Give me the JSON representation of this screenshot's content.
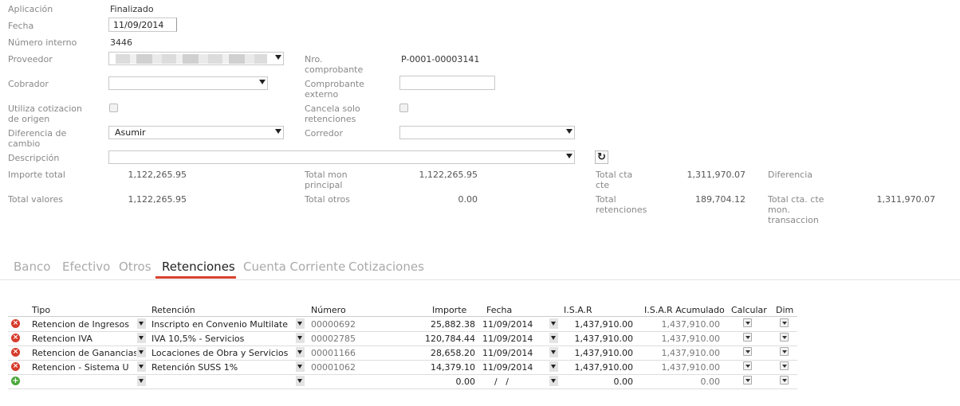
{
  "form": {
    "aplicacion_label": "Aplicación",
    "aplicacion_value": "Finalizado",
    "fecha_label": "Fecha",
    "fecha_value": "11/09/2014",
    "numero_interno_label": "Número interno",
    "numero_interno_value": "3446",
    "proveedor_label": "Proveedor",
    "nro_comprobante_label_1": "Nro.",
    "nro_comprobante_label_2": "comprobante",
    "nro_comprobante_value": "P-0001-00003141",
    "cobrador_label": "Cobrador",
    "comprobante_externo_label_1": "Comprobante",
    "comprobante_externo_label_2": "externo",
    "utiliza_label_1": "Utiliza cotizacion",
    "utiliza_label_2": "de origen",
    "cancela_label_1": "Cancela solo",
    "cancela_label_2": "retenciones",
    "diferencia_cambio_label_1": "Diferencia de",
    "diferencia_cambio_label_2": "cambio",
    "diferencia_cambio_value": "Asumir",
    "corredor_label": "Corredor",
    "descripcion_label": "Descripción"
  },
  "totals": {
    "importe_total_label": "Importe total",
    "importe_total_value": "1,122,265.95",
    "total_mon_label_1": "Total mon",
    "total_mon_label_2": "principal",
    "total_mon_value": "1,122,265.95",
    "total_cta_label_1": "Total cta",
    "total_cta_label_2": "cte",
    "total_cta_value": "1,311,970.07",
    "diferencia_label": "Diferencia",
    "total_valores_label": "Total valores",
    "total_valores_value": "1,122,265.95",
    "total_otros_label": "Total otros",
    "total_otros_value": "0.00",
    "total_retenciones_label_1": "Total",
    "total_retenciones_label_2": "retenciones",
    "total_retenciones_value": "189,704.12",
    "total_cta_mon_label_1": "Total cta. cte",
    "total_cta_mon_label_2": "mon.",
    "total_cta_mon_label_3": "transaccion",
    "total_cta_mon_value": "1,311,970.07"
  },
  "tabs": [
    "Banco",
    "Efectivo",
    "Otros",
    "Retenciones",
    "Cuenta Corriente",
    "Cotizaciones"
  ],
  "table": {
    "headers": [
      "Tipo",
      "Retención",
      "Número",
      "Importe",
      "Fecha",
      "I.S.A.R",
      "I.S.A.R Acumulado",
      "Calcular",
      "Dim"
    ],
    "rows": [
      [
        "Retencion de Ingresos",
        "Inscripto en Convenio Multilate",
        "00000692",
        "25,882.38",
        "11/09/2014",
        "1,437,910.00",
        "1,437,910.00"
      ],
      [
        "Retencion IVA",
        "IVA 10,5% - Servicios",
        "00002785",
        "120,784.44",
        "11/09/2014",
        "1,437,910.00",
        "1,437,910.00"
      ],
      [
        "Retencion de Ganancias",
        "Locaciones de Obra y Servicios",
        "00001166",
        "28,658.20",
        "11/09/2014",
        "1,437,910.00",
        "1,437,910.00"
      ],
      [
        "Retencion - Sistema U",
        "Retención SUSS 1%",
        "00001062",
        "14,379.10",
        "11/09/2014",
        "1,437,910.00",
        "1,437,910.00"
      ]
    ],
    "new_row": [
      "",
      "",
      "",
      "0.00",
      "/   /",
      "0.00",
      "0.00"
    ]
  },
  "icons": {
    "delete": "delete-circle-icon",
    "add": "add-circle-icon",
    "refresh": "refresh-icon",
    "dropdown": "chevron-down-icon"
  },
  "colors": {
    "accent": "#d9412d",
    "delete": "#d63b2b",
    "add": "#4aa83a"
  }
}
